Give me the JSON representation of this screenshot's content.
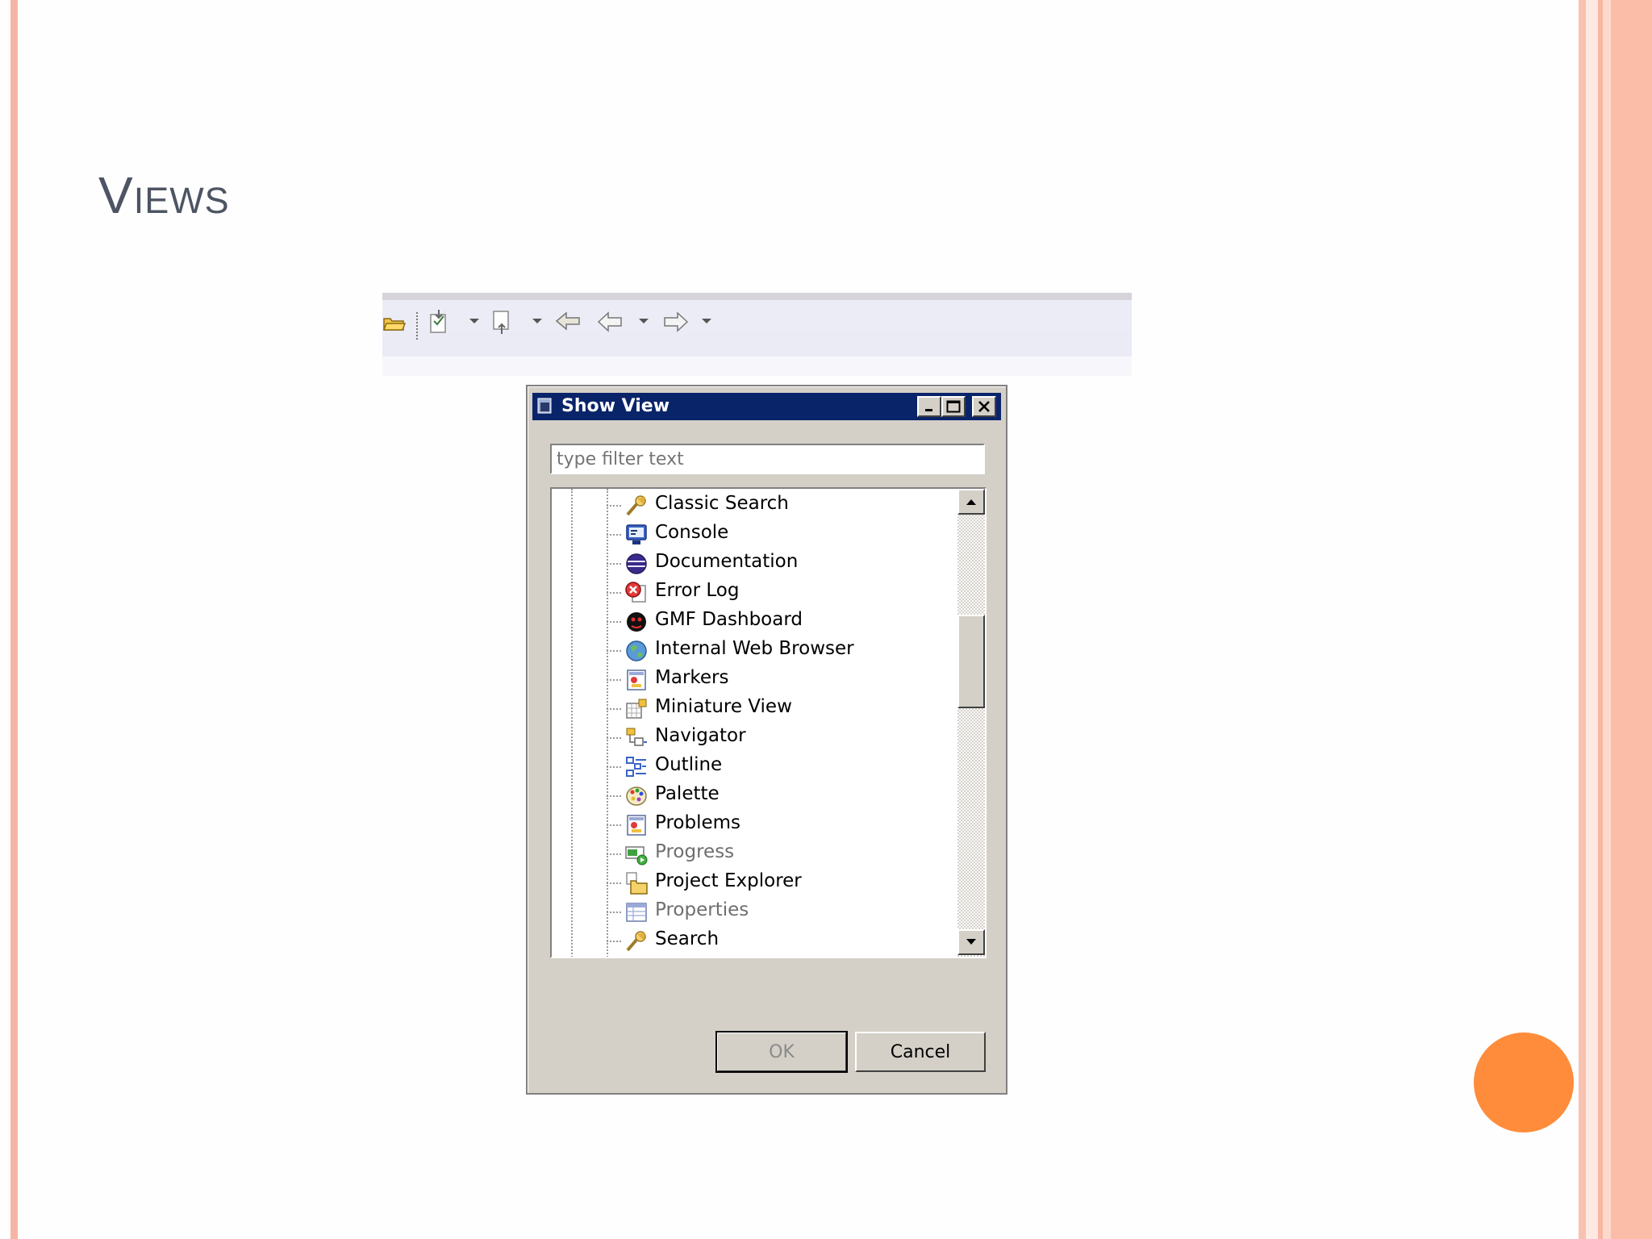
{
  "slide": {
    "title": "Views"
  },
  "dialog": {
    "title": "Show View",
    "filter_placeholder": "type filter text",
    "items": [
      {
        "label": "Classic Search",
        "icon": "classic-search-icon",
        "enabled": true
      },
      {
        "label": "Console",
        "icon": "console-icon",
        "enabled": true
      },
      {
        "label": "Documentation",
        "icon": "documentation-icon",
        "enabled": true
      },
      {
        "label": "Error Log",
        "icon": "error-log-icon",
        "enabled": true
      },
      {
        "label": "GMF Dashboard",
        "icon": "gmf-dashboard-icon",
        "enabled": true
      },
      {
        "label": "Internal Web Browser",
        "icon": "globe-icon",
        "enabled": true
      },
      {
        "label": "Markers",
        "icon": "markers-icon",
        "enabled": true
      },
      {
        "label": "Miniature View",
        "icon": "miniature-view-icon",
        "enabled": true
      },
      {
        "label": "Navigator",
        "icon": "navigator-icon",
        "enabled": true
      },
      {
        "label": "Outline",
        "icon": "outline-icon",
        "enabled": true
      },
      {
        "label": "Palette",
        "icon": "palette-icon",
        "enabled": true
      },
      {
        "label": "Problems",
        "icon": "problems-icon",
        "enabled": true
      },
      {
        "label": "Progress",
        "icon": "progress-icon",
        "enabled": false
      },
      {
        "label": "Project Explorer",
        "icon": "project-explorer-icon",
        "enabled": true
      },
      {
        "label": "Properties",
        "icon": "properties-icon",
        "enabled": false
      },
      {
        "label": "Search",
        "icon": "search-icon",
        "enabled": true
      }
    ],
    "ok_label": "OK",
    "cancel_label": "Cancel"
  },
  "colors": {
    "titlebar": "#0a246a",
    "accent_dot": "#ff8c3a",
    "slide_border": "#f6b5a4"
  }
}
